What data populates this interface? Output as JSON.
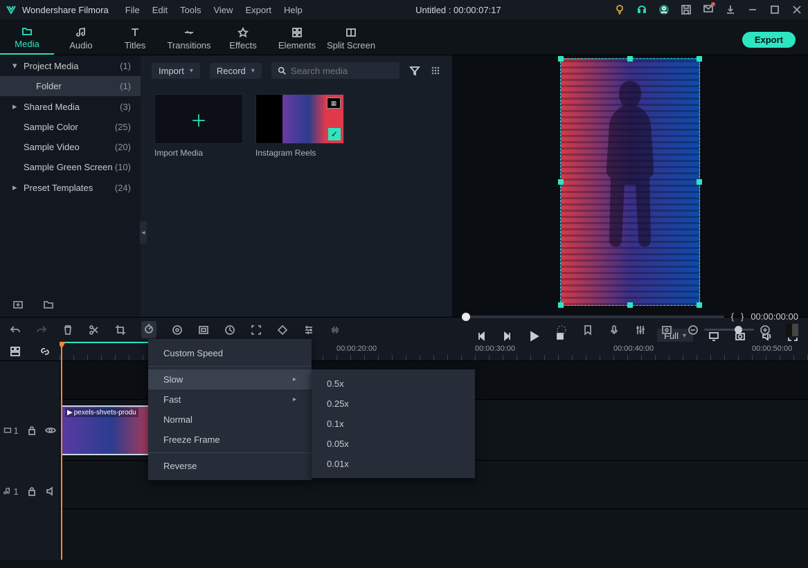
{
  "app": {
    "name": "Wondershare Filmora",
    "title": "Untitled : 00:00:07:17"
  },
  "menu": {
    "file": "File",
    "edit": "Edit",
    "tools": "Tools",
    "view": "View",
    "export": "Export",
    "help": "Help"
  },
  "tabs": {
    "media": "Media",
    "audio": "Audio",
    "titles": "Titles",
    "transitions": "Transitions",
    "effects": "Effects",
    "elements": "Elements",
    "splitscreen": "Split Screen"
  },
  "export_button": "Export",
  "sidebar": {
    "project_media": {
      "label": "Project Media",
      "count": "(1)"
    },
    "folder": {
      "label": "Folder",
      "count": "(1)"
    },
    "shared_media": {
      "label": "Shared Media",
      "count": "(3)"
    },
    "sample_color": {
      "label": "Sample Color",
      "count": "(25)"
    },
    "sample_video": {
      "label": "Sample Video",
      "count": "(20)"
    },
    "sample_green": {
      "label": "Sample Green Screen",
      "count": "(10)"
    },
    "preset_templates": {
      "label": "Preset Templates",
      "count": "(24)"
    }
  },
  "media_panel": {
    "import": "Import",
    "record": "Record",
    "search_placeholder": "Search media",
    "import_media": "Import Media",
    "reels": "Instagram Reels"
  },
  "preview": {
    "loop_l": "{",
    "loop_r": "}",
    "time": "00:00:00:00",
    "quality": "Full"
  },
  "ruler": {
    "t0": "00:00:20:00",
    "t1": "00:00:30:00",
    "t2": "00:00:40:00",
    "t3": "00:00:50:00"
  },
  "tracks": {
    "video": "1",
    "audio": "1"
  },
  "clip": {
    "name": "pexels-shvets-produ"
  },
  "speed_menu": {
    "custom": "Custom Speed",
    "slow": "Slow",
    "fast": "Fast",
    "normal": "Normal",
    "freeze": "Freeze Frame",
    "reverse": "Reverse"
  },
  "slow_sub": {
    "a": "0.5x",
    "b": "0.25x",
    "c": "0.1x",
    "d": "0.05x",
    "e": "0.01x"
  }
}
